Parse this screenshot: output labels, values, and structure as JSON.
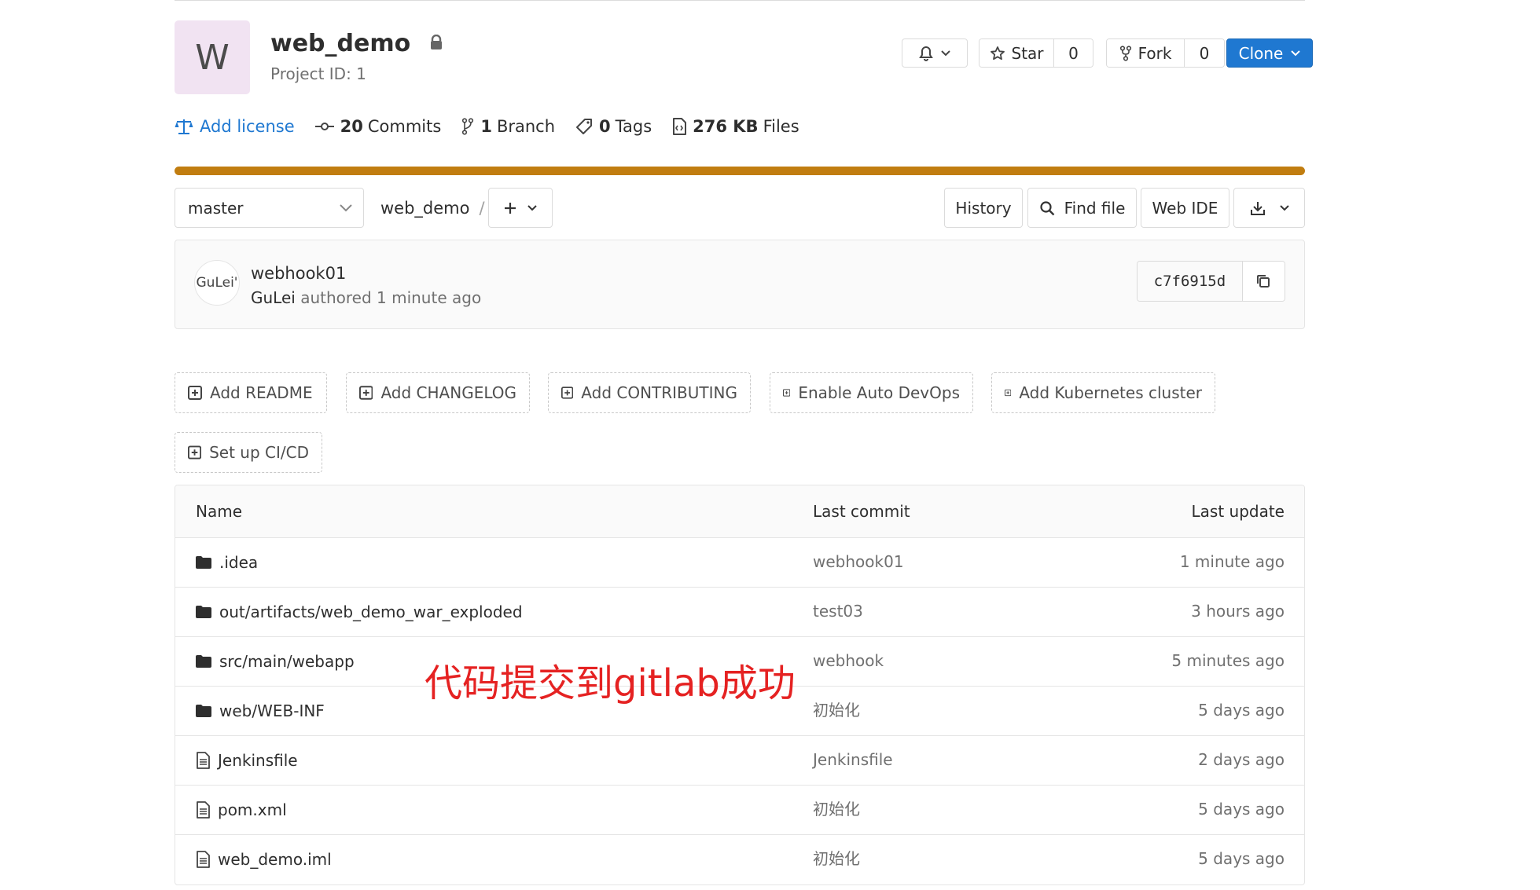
{
  "project": {
    "avatar_letter": "W",
    "name": "web_demo",
    "id_text": "Project ID: 1"
  },
  "actions": {
    "star_label": "Star",
    "star_count": "0",
    "fork_label": "Fork",
    "fork_count": "0",
    "clone_label": "Clone"
  },
  "stats": {
    "license_label": "Add license",
    "commits_count": "20",
    "commits_label": "Commits",
    "branch_count": "1",
    "branch_label": "Branch",
    "tags_count": "0",
    "tags_label": "Tags",
    "files_size": "276 KB",
    "files_label": "Files"
  },
  "tree_nav": {
    "branch": "master",
    "path_root": "web_demo",
    "separator": "/",
    "history_label": "History",
    "find_file_label": "Find file",
    "web_ide_label": "Web IDE"
  },
  "last_commit": {
    "avatar_alt": "GuLei'",
    "title": "webhook01",
    "author": "GuLei",
    "authored_text": "authored 1 minute ago",
    "sha": "c7f6915d"
  },
  "suggestions": [
    "Add README",
    "Add CHANGELOG",
    "Add CONTRIBUTING",
    "Enable Auto DevOps",
    "Add Kubernetes cluster",
    "Set up CI/CD"
  ],
  "table": {
    "headers": {
      "name": "Name",
      "last_commit": "Last commit",
      "last_update": "Last update"
    },
    "rows": [
      {
        "type": "folder",
        "name": ".idea",
        "commit": "webhook01",
        "updated": "1 minute ago"
      },
      {
        "type": "folder",
        "name": "out/artifacts/web_demo_war_exploded",
        "commit": "test03",
        "updated": "3 hours ago"
      },
      {
        "type": "folder",
        "name": "src/main/webapp",
        "commit": "webhook",
        "updated": "5 minutes ago"
      },
      {
        "type": "folder",
        "name": "web/WEB-INF",
        "commit": "初始化",
        "updated": "5 days ago"
      },
      {
        "type": "file",
        "name": "Jenkinsfile",
        "commit": "Jenkinsfile",
        "updated": "2 days ago"
      },
      {
        "type": "file",
        "name": "pom.xml",
        "commit": "初始化",
        "updated": "5 days ago"
      },
      {
        "type": "file",
        "name": "web_demo.iml",
        "commit": "初始化",
        "updated": "5 days ago"
      }
    ]
  },
  "annotation": "代码提交到gitlab成功",
  "colors": {
    "accent": "#1f78d1",
    "progress": "#c17d10",
    "annotation": "#e52222",
    "avatar_bg": "#f1e3f2"
  }
}
